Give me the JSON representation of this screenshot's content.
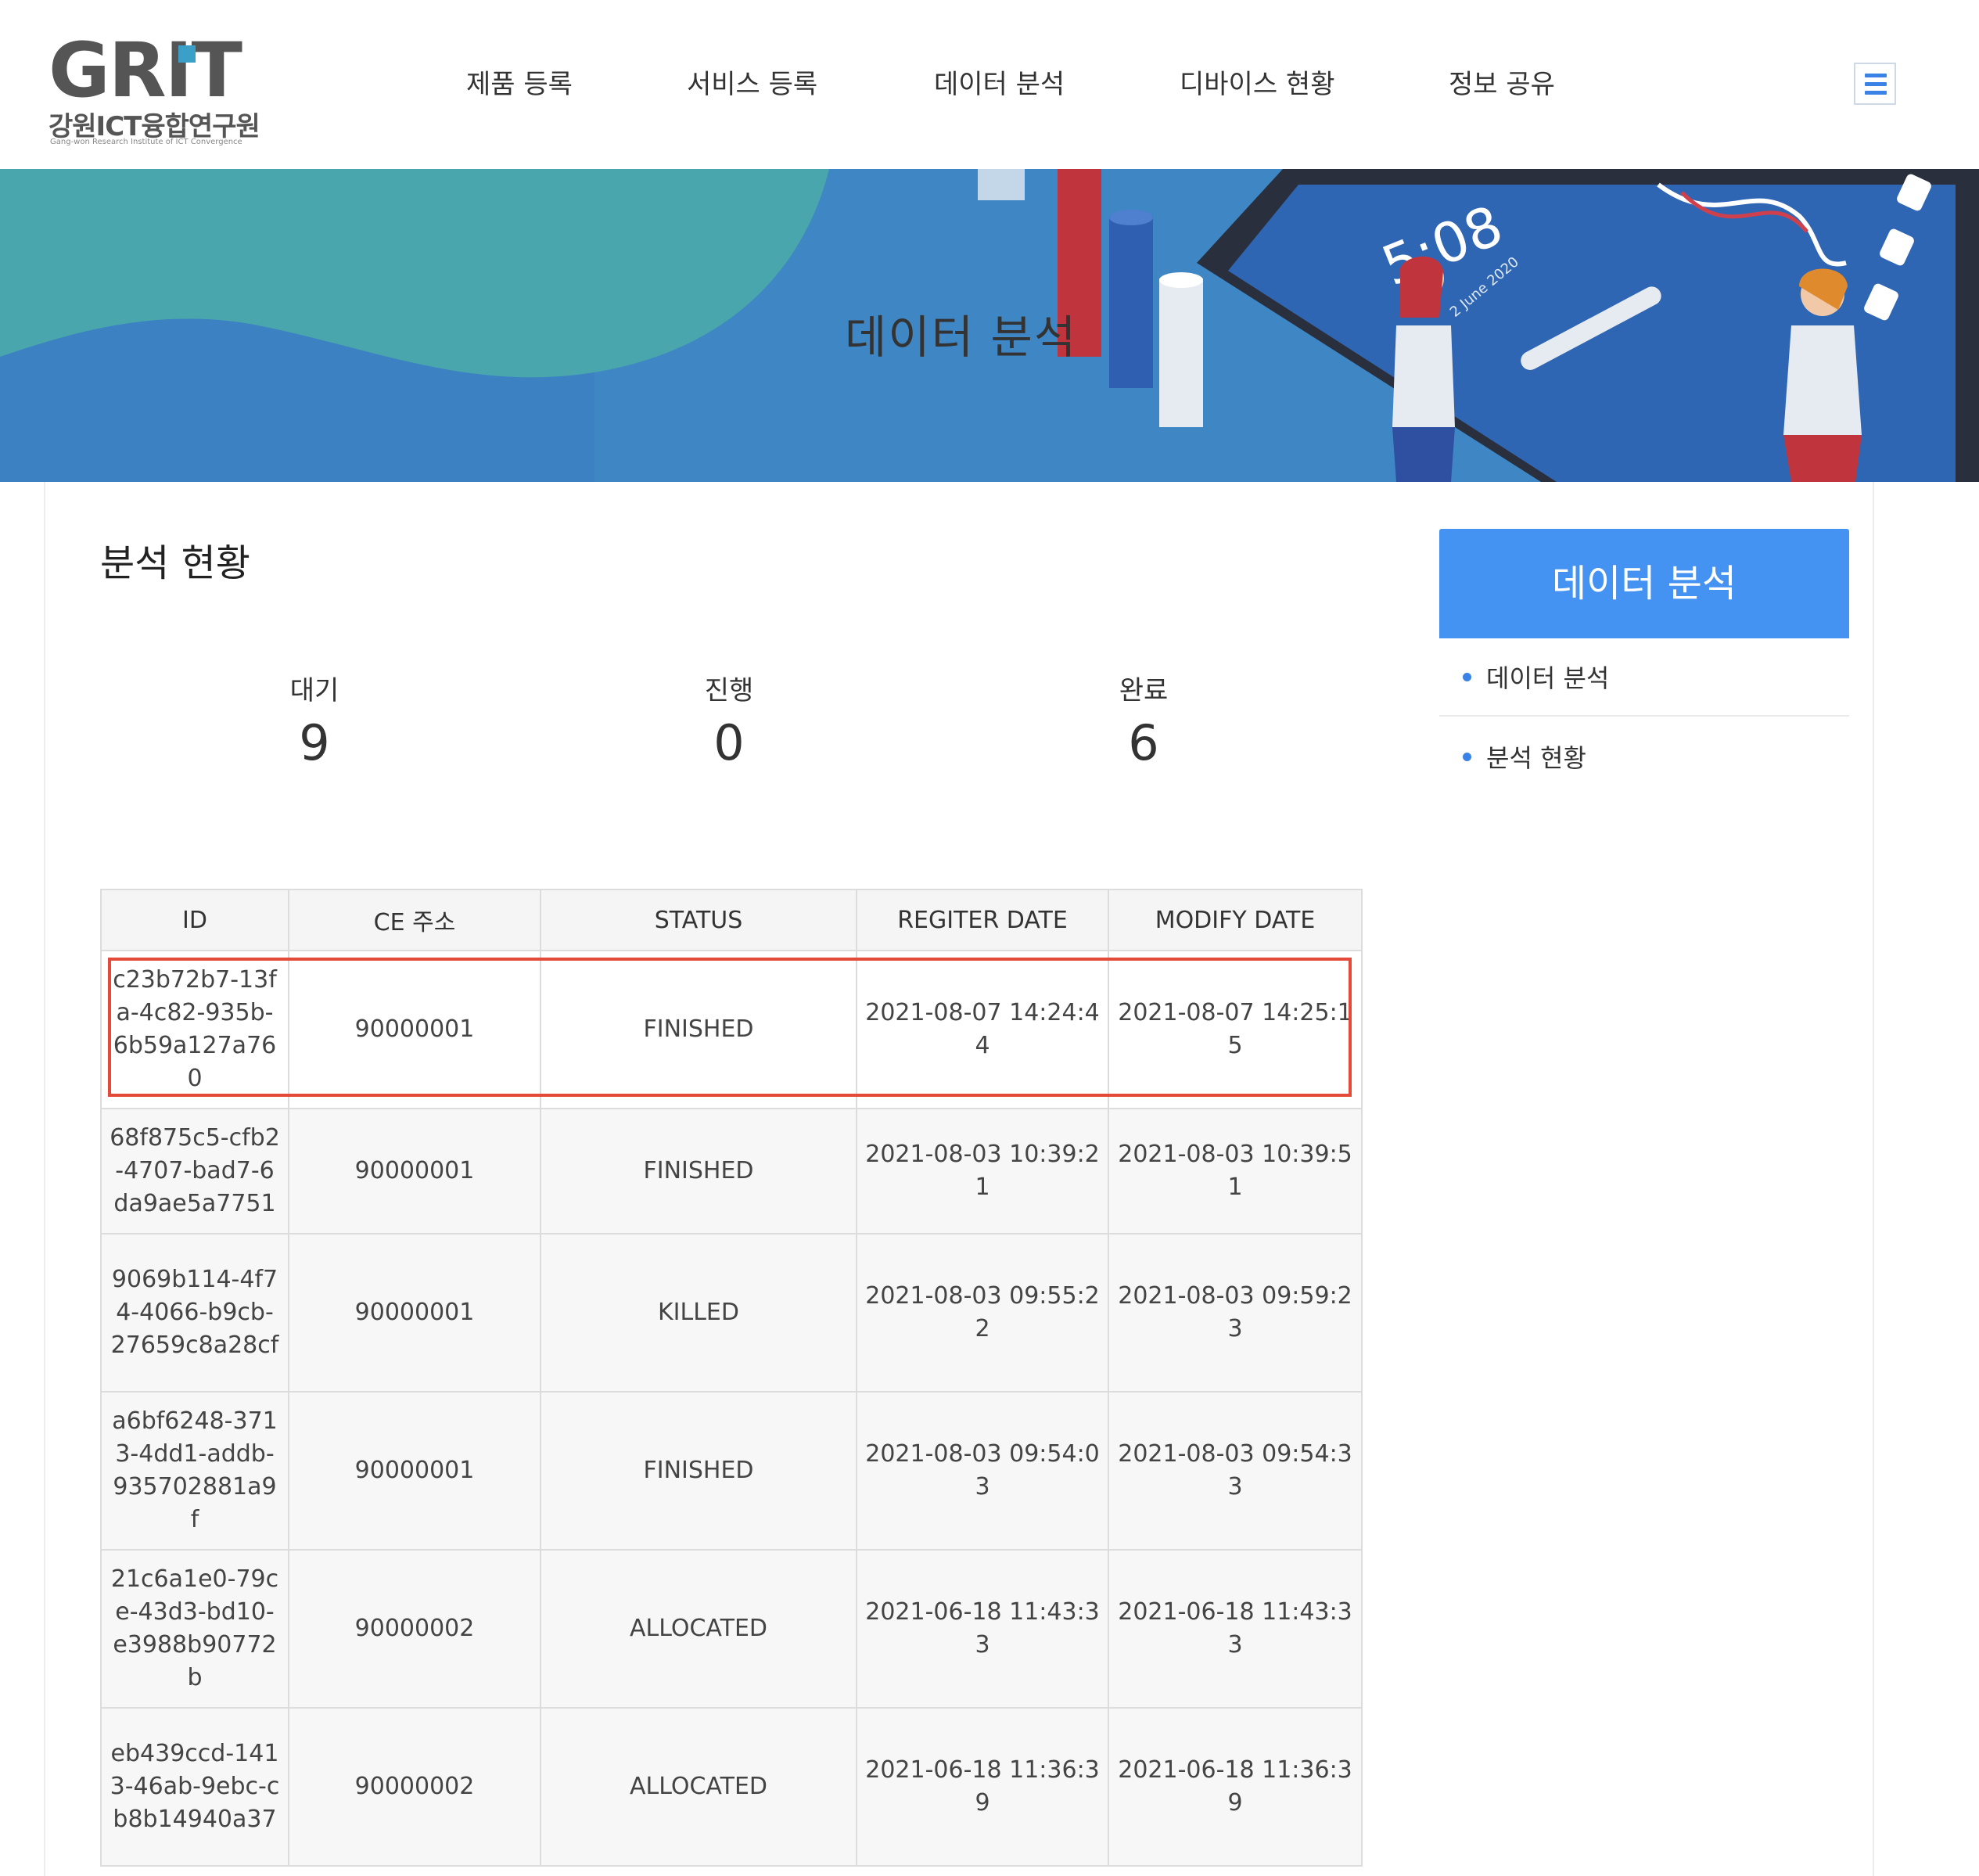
{
  "header": {
    "logo_text": "GRIT",
    "logo_sub": "강원ICT융합연구원",
    "logo_tagline": "Gang-won Research Institute of ICT Convergence",
    "nav": [
      "제품 등록",
      "서비스 등록",
      "데이터 분석",
      "디바이스 현황",
      "정보 공유"
    ],
    "menu_icon": "hamburger-icon"
  },
  "banner": {
    "title": "데이터 분석",
    "phone_time": "5:08",
    "phone_date": "2 June 2020"
  },
  "main": {
    "section_title": "분석 현황",
    "stats": [
      {
        "label": "대기",
        "value": "9"
      },
      {
        "label": "진행",
        "value": "0"
      },
      {
        "label": "완료",
        "value": "6"
      }
    ],
    "table": {
      "columns": [
        "ID",
        "CE 주소",
        "STATUS",
        "REGITER DATE",
        "MODIFY DATE"
      ],
      "rows": [
        {
          "id": "c23b72b7-13fa-4c82-935b-6b59a127a760",
          "ce": "90000001",
          "status": "FINISHED",
          "reg": "2021-08-07 14:24:44",
          "mod": "2021-08-07 14:25:15"
        },
        {
          "id": "68f875c5-cfb2-4707-bad7-6da9ae5a7751",
          "ce": "90000001",
          "status": "FINISHED",
          "reg": "2021-08-03 10:39:21",
          "mod": "2021-08-03 10:39:51"
        },
        {
          "id": "9069b114-4f74-4066-b9cb-27659c8a28cf",
          "ce": "90000001",
          "status": "KILLED",
          "reg": "2021-08-03 09:55:22",
          "mod": "2021-08-03 09:59:23"
        },
        {
          "id": "a6bf6248-3713-4dd1-addb-935702881a9f",
          "ce": "90000001",
          "status": "FINISHED",
          "reg": "2021-08-03 09:54:03",
          "mod": "2021-08-03 09:54:33"
        },
        {
          "id": "21c6a1e0-79ce-43d3-bd10-e3988b90772b",
          "ce": "90000002",
          "status": "ALLOCATED",
          "reg": "2021-06-18 11:43:33",
          "mod": "2021-06-18 11:43:33"
        },
        {
          "id": "eb439ccd-1413-46ab-9ebc-cb8b14940a37",
          "ce": "90000002",
          "status": "ALLOCATED",
          "reg": "2021-06-18 11:36:39",
          "mod": "2021-06-18 11:36:39"
        }
      ]
    }
  },
  "sidebar": {
    "title": "데이터 분석",
    "items": [
      "데이터 분석",
      "분석 현황"
    ]
  },
  "colors": {
    "accent": "#4492f2",
    "highlight_border": "#e34a3a",
    "banner_bg": "#3f86c4",
    "logo_accent": "#3aa0c8"
  }
}
